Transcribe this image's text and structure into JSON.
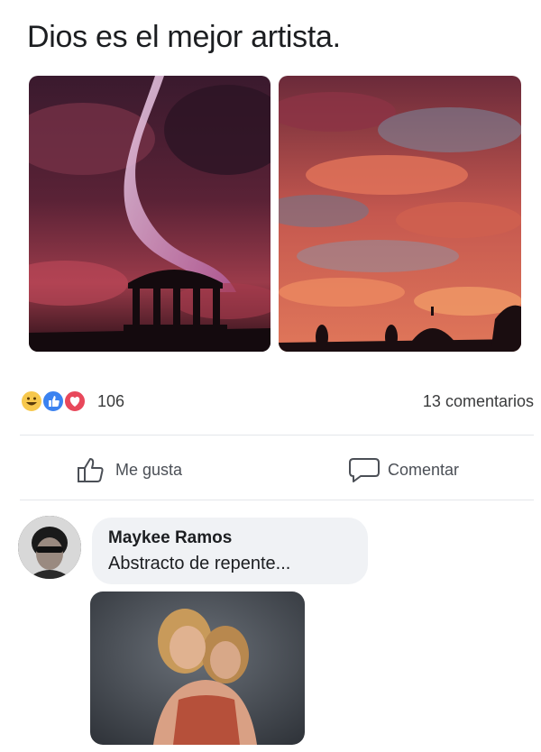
{
  "post": {
    "text": "Dios es el mejor artista.",
    "photos": [
      {
        "name": "photo-left",
        "description_icon": "storm-gazebo-photo"
      },
      {
        "name": "photo-right",
        "description_icon": "sunset-clouds-photo"
      }
    ]
  },
  "reactions": {
    "icons": [
      "haha-icon",
      "like-icon",
      "love-icon"
    ],
    "count": "106",
    "comments_count": "13 comentarios"
  },
  "actions": {
    "like_label": "Me gusta",
    "comment_label": "Comentar"
  },
  "comment": {
    "author": "Maykee Ramos",
    "text": "Abstracto de repente..."
  },
  "colors": {
    "like_blue": "#3b82f0",
    "love_red": "#e8485b",
    "haha_yellow": "#f7c84d",
    "bubble_bg": "#f0f2f5",
    "divider": "#e4e6eb"
  }
}
